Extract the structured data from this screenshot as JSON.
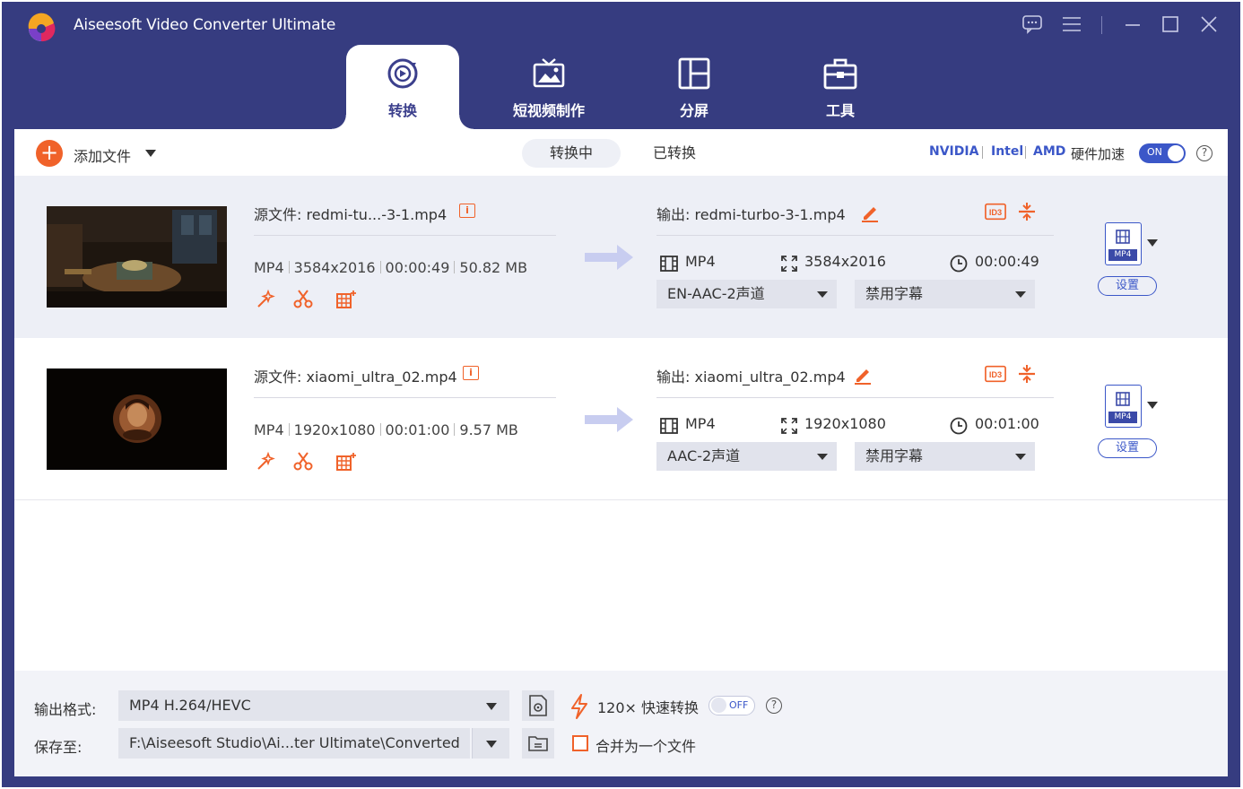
{
  "app": {
    "title": "Aiseesoft Video Converter Ultimate"
  },
  "nav": {
    "tabs": [
      {
        "label": "转换",
        "icon": "convert-icon",
        "active": true
      },
      {
        "label": "短视频制作",
        "icon": "mv-tv-icon",
        "active": false
      },
      {
        "label": "分屏",
        "icon": "collage-icon",
        "active": false
      },
      {
        "label": "工具",
        "icon": "toolbox-icon",
        "active": false
      }
    ]
  },
  "toolbar": {
    "add_files": "添加文件",
    "converting": "转换中",
    "converted": "已转换",
    "hw_vendors": [
      "NVIDIA",
      "Intel",
      "AMD"
    ],
    "hw_accel_label": "硬件加速",
    "hw_toggle": "ON"
  },
  "files": [
    {
      "source_label": "源文件:",
      "source_name": "redmi-tu...-3-1.mp4",
      "format": "MP4",
      "resolution": "3584x2016",
      "duration": "00:00:49",
      "size": "50.82 MB",
      "output_label": "输出:",
      "output_name": "redmi-turbo-3-1.mp4",
      "out_format": "MP4",
      "out_resolution": "3584x2016",
      "out_duration": "00:00:49",
      "audio_track": "EN-AAC-2声道",
      "subtitle": "禁用字幕",
      "format_tag": "MP4",
      "settings": "设置"
    },
    {
      "source_label": "源文件:",
      "source_name": "xiaomi_ultra_02.mp4",
      "format": "MP4",
      "resolution": "1920x1080",
      "duration": "00:01:00",
      "size": "9.57 MB",
      "output_label": "输出:",
      "output_name": "xiaomi_ultra_02.mp4",
      "out_format": "MP4",
      "out_resolution": "1920x1080",
      "out_duration": "00:01:00",
      "audio_track": "AAC-2声道",
      "subtitle": "禁用字幕",
      "format_tag": "MP4",
      "settings": "设置"
    }
  ],
  "bottom": {
    "output_format_label": "输出格式:",
    "output_format_value": "MP4 H.264/HEVC",
    "save_to_label": "保存至:",
    "save_to_value": "F:\\Aiseesoft Studio\\Ai...ter Ultimate\\Converted",
    "speed_label": "120× 快速转换",
    "speed_toggle": "OFF",
    "merge_label": "合并为一个文件"
  },
  "colors": {
    "frame": "#363c80",
    "accent": "#3b57c8",
    "orange": "#f0622a",
    "row_selected": "#edeff6"
  }
}
